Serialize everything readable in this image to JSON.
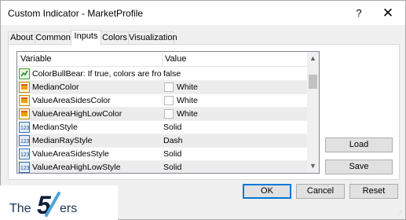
{
  "window": {
    "title": "Custom Indicator - MarketProfile",
    "help_glyph": "?",
    "close_glyph": "✕"
  },
  "tabs": [
    {
      "label": "About",
      "active": false
    },
    {
      "label": "Common",
      "active": false
    },
    {
      "label": "Inputs",
      "active": true
    },
    {
      "label": "Colors",
      "active": false
    },
    {
      "label": "Visualization",
      "active": false
    }
  ],
  "inputs_table": {
    "columns": [
      "Variable",
      "Value"
    ],
    "rows": [
      {
        "icon": "boolean-icon",
        "name": "ColorBullBear: If true, colors are from b...",
        "value": "false",
        "color_swatch": false
      },
      {
        "icon": "color-icon",
        "name": "MedianColor",
        "value": "White",
        "color_swatch": true
      },
      {
        "icon": "color-icon",
        "name": "ValueAreaSidesColor",
        "value": "White",
        "color_swatch": true
      },
      {
        "icon": "color-icon",
        "name": "ValueAreaHighLowColor",
        "value": "White",
        "color_swatch": true
      },
      {
        "icon": "number-icon",
        "name": "MedianStyle",
        "value": "Solid",
        "color_swatch": false
      },
      {
        "icon": "number-icon",
        "name": "MedianRayStyle",
        "value": "Dash",
        "color_swatch": false
      },
      {
        "icon": "number-icon",
        "name": "ValueAreaSidesStyle",
        "value": "Solid",
        "color_swatch": false
      },
      {
        "icon": "number-icon",
        "name": "ValueAreaHighLowStyle",
        "value": "Solid",
        "color_swatch": false
      }
    ]
  },
  "side_buttons": {
    "load_label": "Load",
    "save_label": "Save"
  },
  "footer_buttons": {
    "ok_label": "OK",
    "cancel_label": "Cancel",
    "reset_label": "Reset"
  },
  "watermark": {
    "logo_text": "The 5%ers",
    "the": "The",
    "five": "5",
    "ers": "ers",
    "color_text": "#1a3655",
    "color_five": "#0d1f3a",
    "color_slash": "#4ea3d9"
  },
  "colors": {
    "accent": "#0078d7",
    "row_alt": "#ececec"
  }
}
